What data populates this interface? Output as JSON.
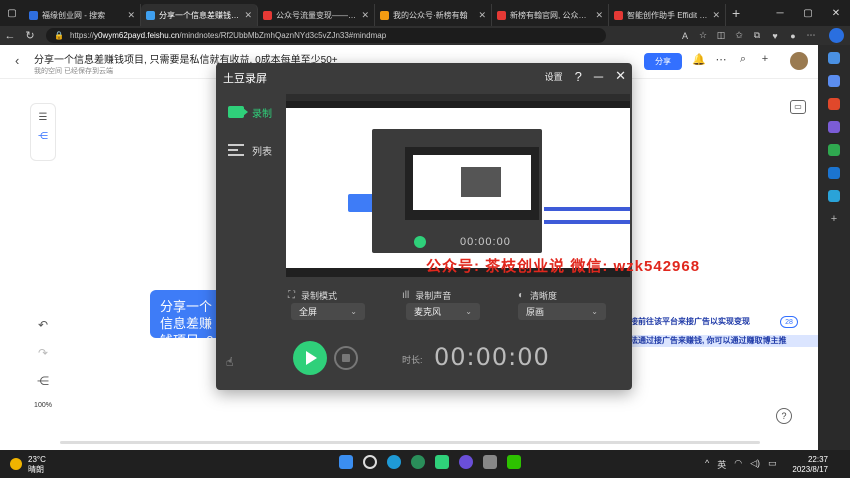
{
  "browser": {
    "tabs": [
      {
        "title": "福缘创业网 - 搜索",
        "color": "#2f6fe0",
        "active": false
      },
      {
        "title": "分享一个信息差赚钱项目,",
        "color": "#3fa0f0",
        "active": true
      },
      {
        "title": "公众号流量变现——新榜有",
        "color": "#e53935",
        "active": false
      },
      {
        "title": "我的公众号·新榜有翰",
        "color": "#f39c12",
        "active": false
      },
      {
        "title": "新榜有翰官网, 公众号流量",
        "color": "#e53935",
        "active": false
      },
      {
        "title": "智能创作助手 Effidit | AI智",
        "color": "#e53935",
        "active": false
      }
    ],
    "new_tab": "+",
    "url_prefix": "https://",
    "url_host": "y0wym62payd.feishu.cn",
    "url_path": "/mindnotes/Rf2UbbMbZmhQaznNYd3c5vZJn33#mindmap"
  },
  "doc": {
    "title": "分享一个信息差赚钱项目, 只需要是私信就有收益, 0成本每单至少50+",
    "subtitle": "我的空间   已经保存到云端",
    "share_label": "分享",
    "node_text": "分享一个信息差赚钱项目, 0成本每单",
    "right_text_1": "接前往该平台来接广告以实现变现",
    "badge": "28",
    "right_text_2": "法通过接广告来赚钱, 你可以通过赚取博主推",
    "zoom": "100%"
  },
  "recorder": {
    "title": "土豆录屏",
    "settings_label": "设置",
    "nav": [
      {
        "label": "录制"
      },
      {
        "label": "列表"
      }
    ],
    "watermark": "公众号: 茶枝创业说  微信: wzk542968",
    "preview_time": "00:00:00",
    "mode_label": "录制模式",
    "mode_value": "全屏",
    "audio_label": "录制声音",
    "audio_value": "麦克风",
    "quality_label": "清晰度",
    "quality_value": "原画",
    "duration_label": "时长:",
    "duration": "00:00:00"
  },
  "taskbar": {
    "temperature": "23°C",
    "weather": "晴朗",
    "ime": "英",
    "time": "22:37",
    "date": "2023/8/17"
  }
}
